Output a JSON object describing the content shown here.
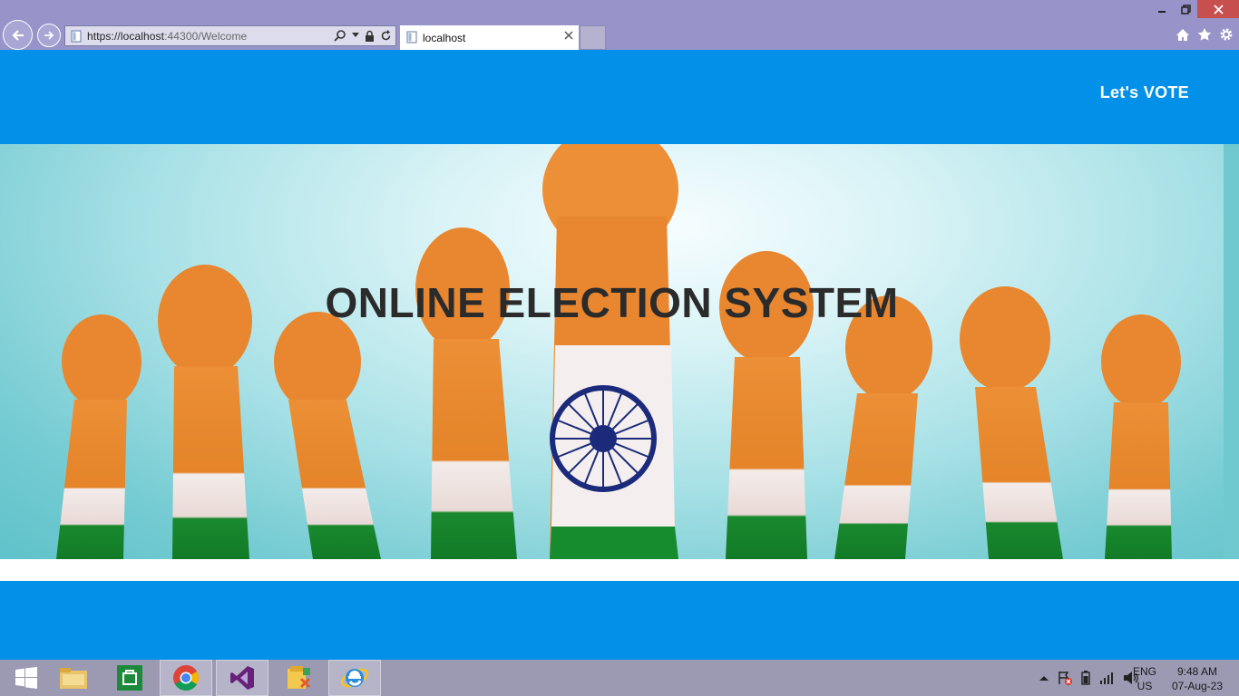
{
  "browser": {
    "url_scheme_host": "https://localhost",
    "url_port_path": ":44300/Welcome",
    "tab_title": "localhost"
  },
  "site": {
    "brand": "Let's VOTE",
    "hero_title": "ONLINE ELECTION SYSTEM"
  },
  "taskbar": {
    "apps": [
      "start",
      "file-explorer",
      "store",
      "chrome",
      "visual-studio",
      "file-manager",
      "internet-explorer"
    ],
    "language_line1": "ENG",
    "language_line2": "US",
    "time": "9:48 AM",
    "date": "07-Aug-23"
  },
  "colors": {
    "page_blue": "#0290e9",
    "chrome_purple": "#9894c9",
    "saffron": "#e8892f",
    "green": "#138a2e",
    "chakra_navy": "#1b2a7a"
  }
}
